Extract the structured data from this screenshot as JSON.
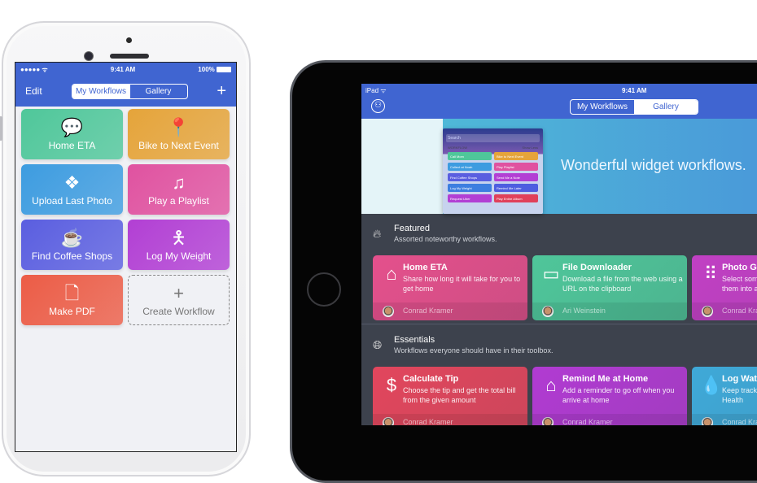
{
  "iphone": {
    "status": {
      "carrier": "●●●●● ᯤ",
      "time": "9:41 AM",
      "battery": "100%"
    },
    "nav": {
      "edit": "Edit",
      "segments": [
        "My Workflows",
        "Gallery"
      ],
      "selected": "My Workflows",
      "add": "+"
    },
    "tiles": [
      {
        "label": "Home ETA",
        "icon": "speech-bubble-icon",
        "glyph": "💬",
        "color": "#4fc79a"
      },
      {
        "label": "Bike to Next Event",
        "icon": "location-pin-icon",
        "glyph": "📍",
        "color": "#e5a43a"
      },
      {
        "label": "Upload Last Photo",
        "icon": "dropbox-icon",
        "glyph": "❖",
        "color": "#3d9ce0"
      },
      {
        "label": "Play a Playlist",
        "icon": "music-note-icon",
        "glyph": "♫",
        "color": "#e052a0"
      },
      {
        "label": "Find Coffee Shops",
        "icon": "coffee-cup-icon",
        "glyph": "☕",
        "color": "#5a5ee0"
      },
      {
        "label": "Log My Weight",
        "icon": "person-icon",
        "glyph": "🯅",
        "color": "#b23fd4"
      },
      {
        "label": "Make PDF",
        "icon": "document-icon",
        "glyph": "🗋",
        "color": "#ec5c46"
      },
      {
        "label": "Create Workflow",
        "icon": "plus-icon",
        "glyph": "+",
        "color": "transparent"
      }
    ]
  },
  "ipad": {
    "status": {
      "device": "iPad ᯤ",
      "time": "9:41 AM"
    },
    "nav": {
      "segments": [
        "My Workflows",
        "Gallery"
      ],
      "selected": "Gallery"
    },
    "banner": {
      "title": "Wonderful widget workflows.",
      "mini": {
        "search": "Search",
        "header": "WORKFLOW",
        "toggle": "Show Less",
        "items": [
          "Call Mom",
          "Bike to Next Event",
          "Collect at Noah",
          "Play Playlist",
          "Find Coffee Shops",
          "Send Me a Note",
          "Log My Weight",
          "Remind Me Later",
          "Request Uber",
          "Play Entire Album"
        ]
      }
    },
    "sections": [
      {
        "name": "Featured",
        "desc": "Assorted noteworthy workflows.",
        "icon": "flame-icon",
        "cards": [
          {
            "title": "Home ETA",
            "desc": "Share how long it will take for you to get home",
            "author": "Conrad Kramer",
            "icon": "house-icon",
            "glyph": "⌂",
            "color": "#e4508c"
          },
          {
            "title": "File Downloader",
            "desc": "Download a file from the web using a URL on the clipboard",
            "author": "Ari Weinstein",
            "icon": "drive-icon",
            "glyph": "▭",
            "color": "#4fc69a"
          },
          {
            "title": "Photo Grid",
            "desc": "Select some photos and combine them into a grid",
            "author": "Conrad Kramer",
            "icon": "grid-icon",
            "glyph": "⠿",
            "color": "#c140c4"
          }
        ]
      },
      {
        "name": "Essentials",
        "desc": "Workflows everyone should have in their toolbox.",
        "icon": "globe-icon",
        "cards": [
          {
            "title": "Calculate Tip",
            "desc": "Choose the tip and get the total bill from the given amount",
            "author": "Conrad Kramer",
            "icon": "dollar-icon",
            "glyph": "$",
            "color": "#e2465d"
          },
          {
            "title": "Remind Me at Home",
            "desc": "Add a reminder to go off when you arrive at home",
            "author": "Conrad Kramer",
            "icon": "house-icon",
            "glyph": "⌂",
            "color": "#b13bd2"
          },
          {
            "title": "Log Water",
            "desc": "Keep track of water by adding it to Health",
            "author": "Conrad Kramer",
            "icon": "water-drop-icon",
            "glyph": "💧",
            "color": "#3fa9d8"
          }
        ]
      }
    ]
  }
}
